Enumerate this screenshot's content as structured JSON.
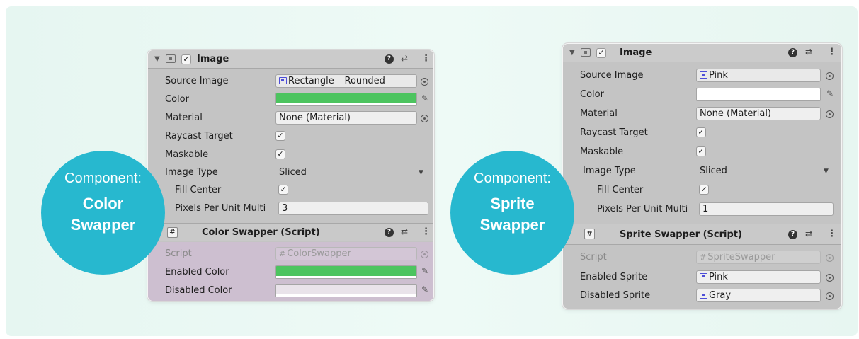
{
  "left": {
    "header": {
      "title": "Image"
    },
    "rows": {
      "source_image": {
        "label": "Source Image",
        "value": "Rectangle – Rounded"
      },
      "color": {
        "label": "Color",
        "swatch": "#4cc45f"
      },
      "material": {
        "label": "Material",
        "value": "None (Material)"
      },
      "raycast": {
        "label": "Raycast Target",
        "check": "✓"
      },
      "maskable": {
        "label": "Maskable",
        "check": "✓"
      },
      "image_type": {
        "label": "Image Type",
        "value": "Sliced"
      },
      "fill_center": {
        "label": "Fill Center",
        "check": "✓"
      },
      "ppu": {
        "label": "Pixels Per Unit Multi",
        "value": "3"
      }
    },
    "script_component": {
      "title": "Color Swapper (Script)",
      "icon": "#",
      "script": {
        "label": "Script",
        "value": "ColorSwapper"
      },
      "enabled": {
        "label": "Enabled Color",
        "swatch": "#4cc45f"
      },
      "disabled": {
        "label": "Disabled Color",
        "swatch": "#e9e3ea"
      }
    },
    "bubble": {
      "caption": "Component:",
      "line1": "Color",
      "line2": "Swapper"
    }
  },
  "right": {
    "header": {
      "title": "Image"
    },
    "rows": {
      "source_image": {
        "label": "Source Image",
        "value": "Pink"
      },
      "color": {
        "label": "Color",
        "swatch": "#ffffff"
      },
      "material": {
        "label": "Material",
        "value": "None (Material)"
      },
      "raycast": {
        "label": "Raycast Target",
        "check": "✓"
      },
      "maskable": {
        "label": "Maskable",
        "check": "✓"
      },
      "image_type": {
        "label": "Image Type",
        "value": "Sliced"
      },
      "fill_center": {
        "label": "Fill Center",
        "check": "✓"
      },
      "ppu": {
        "label": "Pixels Per Unit Multi",
        "value": "1"
      }
    },
    "script_component": {
      "title": "Sprite Swapper (Script)",
      "icon": "#",
      "script": {
        "label": "Script",
        "value": "SpriteSwapper"
      },
      "enabled": {
        "label": "Enabled Sprite",
        "value": "Pink"
      },
      "disabled": {
        "label": "Disabled Sprite",
        "value": "Gray"
      }
    },
    "bubble": {
      "caption": "Component:",
      "line1": "Sprite",
      "line2": "Swapper"
    }
  },
  "icons": {
    "collapse": "▼",
    "checkbox": "✓",
    "help": "?",
    "preset": "⇄",
    "more": "⋮",
    "picker": "✎",
    "dropdown": "▼"
  }
}
